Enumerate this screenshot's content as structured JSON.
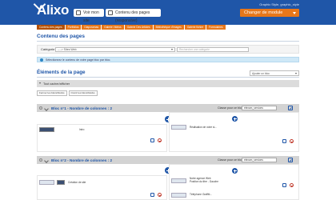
{
  "header": {
    "logo": "Alixo",
    "view_site_button": "Voir mon site",
    "page_content_button": "Contenu des pages (responsive)",
    "user_line": "Graphic Style, graphic_style",
    "module_select": "Changer de module"
  },
  "tabs": [
    {
      "label": "Contenu des pages",
      "active": true
    },
    {
      "label": "Portfolios",
      "active": false
    },
    {
      "label": "Diaporamas",
      "active": false
    },
    {
      "label": "Galerie Vidéos",
      "active": false
    },
    {
      "label": "Galerie Des Articles",
      "active": false
    },
    {
      "label": "Bibliothèque d'images",
      "active": false
    },
    {
      "label": "Galerie fichier",
      "active": false
    },
    {
      "label": "Formulaires",
      "active": false
    }
  ],
  "page_title": "Contenu des pages",
  "category": {
    "label": "Catégorie :",
    "selected": "----> Sites Web",
    "search_placeholder": "Rechercher une catégorie"
  },
  "info_message": "Sélectionnez le contenu de votre page bloc par bloc.",
  "elements_title": "Éléments de la page",
  "add_bloc_select": "Ajouter un bloc",
  "toggle_all": "Tout cacher/afficher",
  "small_buttons": {
    "close_all": "Fermer les blocs/blocks",
    "open_all": "Ouvrir les blocs/blocks"
  },
  "blocs": [
    {
      "title": "Bloc n°1 - Nombre de colonnes : 2",
      "class_label": "Classe pour ce bloc",
      "class_value": "etexam_services",
      "left_item_text": "Intro",
      "right_item_text": "Réalisation de votre si..."
    },
    {
      "title": "Bloc n°2 - Nombre de colonnes : 2",
      "class_label": "Classe pour ce bloc",
      "class_value": "etexam_services",
      "left_item_text": "Création de site",
      "right_item_text": "Notre agence Web\nPosition du titre - Gauche",
      "right_item2_text": "Téléphone Graffiti..."
    }
  ]
}
